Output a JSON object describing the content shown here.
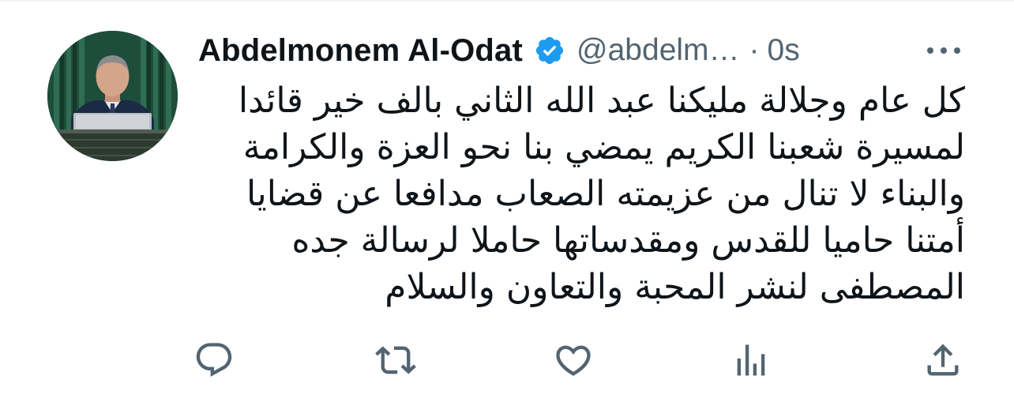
{
  "tweet": {
    "author_name": "Abdelmonem Al-Odat",
    "verified": true,
    "handle": "@abdelm…",
    "separator": "·",
    "timestamp": "0s",
    "text_lines": [
      "كل عام وجلالة مليكنا عبد الله الثاني بالف خير قائدا",
      "لمسيرة شعبنا الكريم يمضي بنا نحو العزة والكرامة",
      "والبناء لا تنال من عزيمته الصعاب مدافعا عن قضايا",
      "أمتنا حاميا للقدس ومقدساتها حاملا لرسالة جده",
      "المصطفى لنشر المحبة والتعاون والسلام"
    ]
  },
  "icons": {
    "avatar": "profile-photo",
    "verified": "verified-badge-icon",
    "more": "more-options-icon",
    "reply": "reply-icon",
    "retweet": "retweet-icon",
    "like": "like-icon",
    "views": "views-icon",
    "share": "share-icon"
  },
  "colors": {
    "text": "#0f1419",
    "secondary": "#536471",
    "verified_blue": "#1d9bf0",
    "divider": "#eff3f4"
  }
}
